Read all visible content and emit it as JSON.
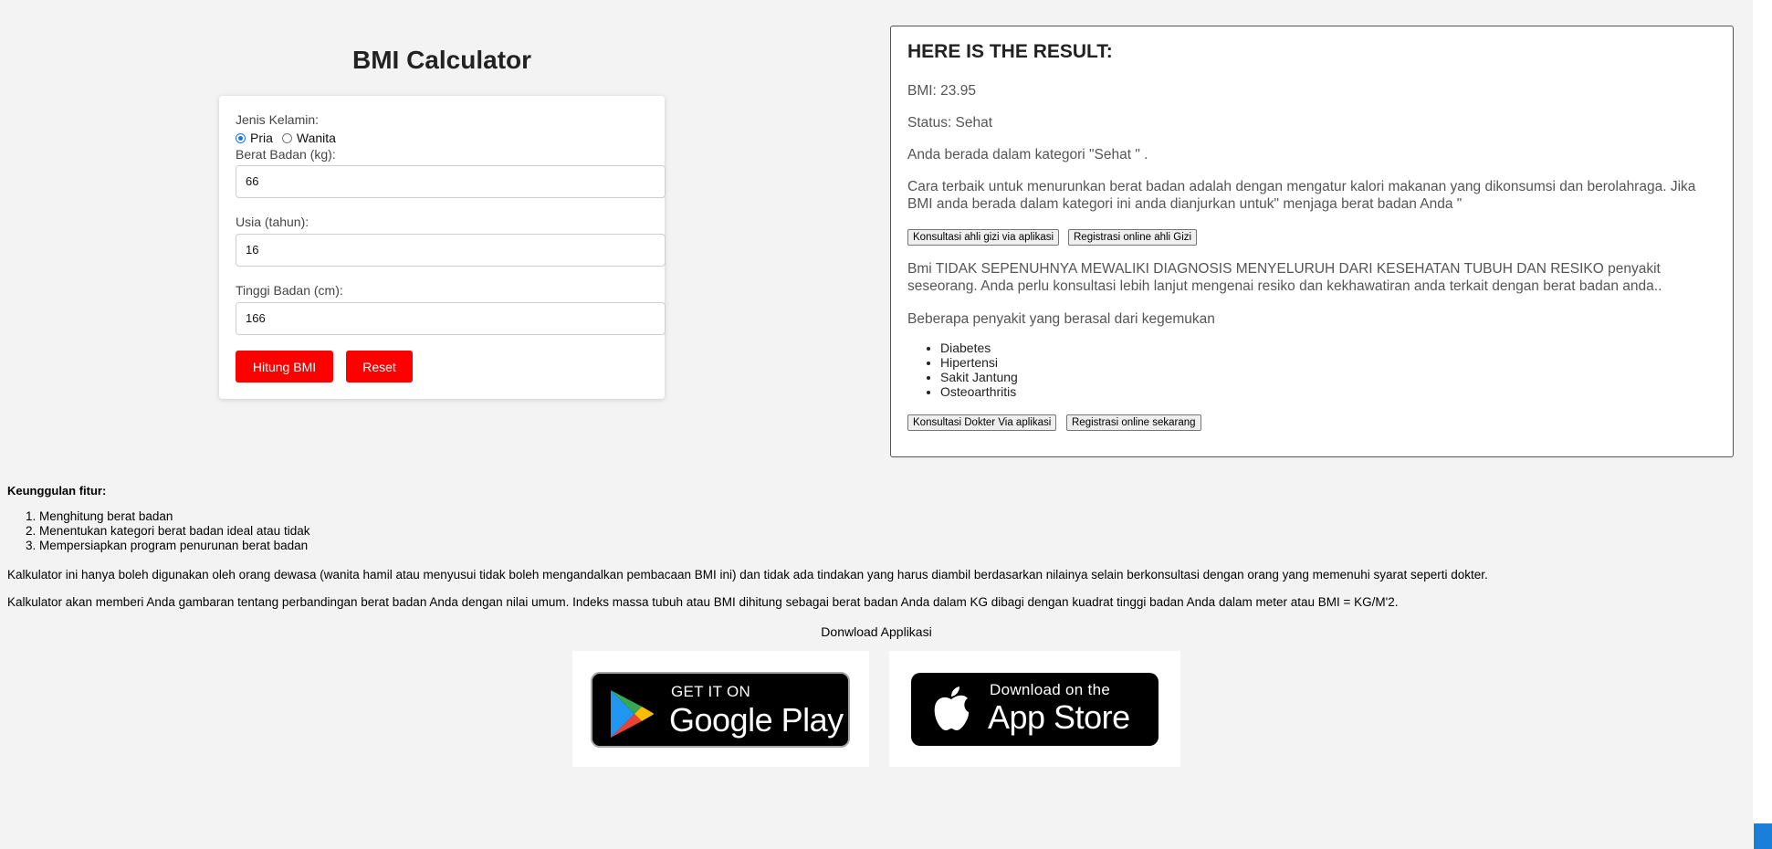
{
  "calculator": {
    "title": "BMI Calculator",
    "gender_label": "Jenis Kelamin:",
    "gender_options": [
      "Pria",
      "Wanita"
    ],
    "gender_selected": "Pria",
    "weight_label": "Berat Badan (kg):",
    "weight_value": "66",
    "age_label": "Usia (tahun):",
    "age_value": "16",
    "height_label": "Tinggi Badan (cm):",
    "height_value": "166",
    "calculate_button": "Hitung BMI",
    "reset_button": "Reset",
    "button_color": "#ff0000"
  },
  "result": {
    "title": "HERE IS THE RESULT:",
    "bmi_text": "BMI: 23.95",
    "status_text": "Status: Sehat",
    "category_text": "Anda berada dalam kategori \"Sehat \" .",
    "advice_text": "Cara terbaik untuk menurunkan berat badan adalah dengan mengatur kalori makanan yang dikonsumsi dan berolahraga. Jika BMI anda berada dalam kategori ini anda dianjurkan untuk\" menjaga berat badan Anda \"",
    "nutrition_consult_button": "Konsultasi ahli gizi via aplikasi",
    "nutrition_register_button": "Registrasi online ahli Gizi",
    "disclaimer_text": "Bmi TIDAK SEPENUHNYA MEWALIKI DIAGNOSIS MENYELURUH DARI KESEHATAN TUBUH DAN RESIKO penyakit seseorang. Anda perlu konsultasi lebih lanjut mengenai resiko dan kekhawatiran anda terkait dengan berat badan anda..",
    "diseases_intro": "Beberapa penyakit yang berasal dari kegemukan",
    "diseases": [
      "Diabetes",
      "Hipertensi",
      "Sakit Jantung",
      "Osteoarthritis"
    ],
    "doctor_consult_button": "Konsultasi Dokter Via aplikasi",
    "doctor_register_button": "Registrasi online sekarang"
  },
  "info": {
    "features_title": "Keunggulan fitur:",
    "features": [
      "Menghitung berat badan",
      "Menentukan kategori berat badan ideal atau tidak",
      "Mempersiapkan program penurunan berat badan"
    ],
    "paragraph_1": "Kalkulator ini hanya boleh digunakan oleh orang dewasa (wanita hamil atau menyusui tidak boleh mengandalkan pembacaan BMI ini) dan tidak ada tindakan yang harus diambil berdasarkan nilainya selain berkonsultasi dengan orang yang memenuhi syarat seperti dokter.",
    "paragraph_2": "Kalkulator akan memberi Anda gambaran tentang perbandingan berat badan Anda dengan nilai umum. Indeks massa tubuh atau BMI dihitung sebagai berat badan Anda dalam KG dibagi dengan kuadrat tinggi badan Anda dalam meter atau BMI = KG/M'2.",
    "download_title": "Donwload Applikasi"
  },
  "stores": {
    "google_play": {
      "small": "GET IT ON",
      "big": "Google Play",
      "icon": "google-play-icon"
    },
    "app_store": {
      "small": "Download on the",
      "big": "App Store",
      "icon": "apple-icon"
    }
  }
}
